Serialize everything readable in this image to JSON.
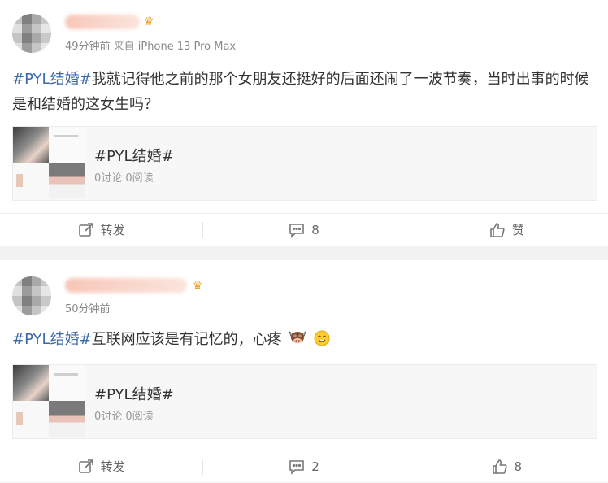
{
  "posts": [
    {
      "meta": "49分钟前 来自 iPhone 13 Pro Max",
      "content_tag": "#PYL结婚#",
      "content_text": "我就记得他之前的那个女朋友还挺好的后面还闹了一波节奏，当时出事的时候是和结婚的这女生吗？",
      "card": {
        "title": "#PYL结婚#",
        "stats": "0讨论 0阅读"
      },
      "actions": {
        "repost": "转发",
        "comments": "8",
        "like": "赞"
      }
    },
    {
      "meta": "50分钟前",
      "content_tag": "#PYL结婚#",
      "content_text": "互联网应该是有记忆的，心疼",
      "card": {
        "title": "#PYL结婚#",
        "stats": "0讨论 0阅读"
      },
      "actions": {
        "repost": "转发",
        "comments": "2",
        "like": "8"
      }
    }
  ],
  "icons": {
    "repost": "repost-icon",
    "comment": "comment-icon",
    "like": "thumbs-up-icon",
    "crown": "crown-badge-icon",
    "cow_emoji": "cow-emoji",
    "smile_emoji": "smile-emoji"
  },
  "colors": {
    "tag": "#3b6aa7",
    "meta": "#888888",
    "background": "#f2f2f2"
  }
}
